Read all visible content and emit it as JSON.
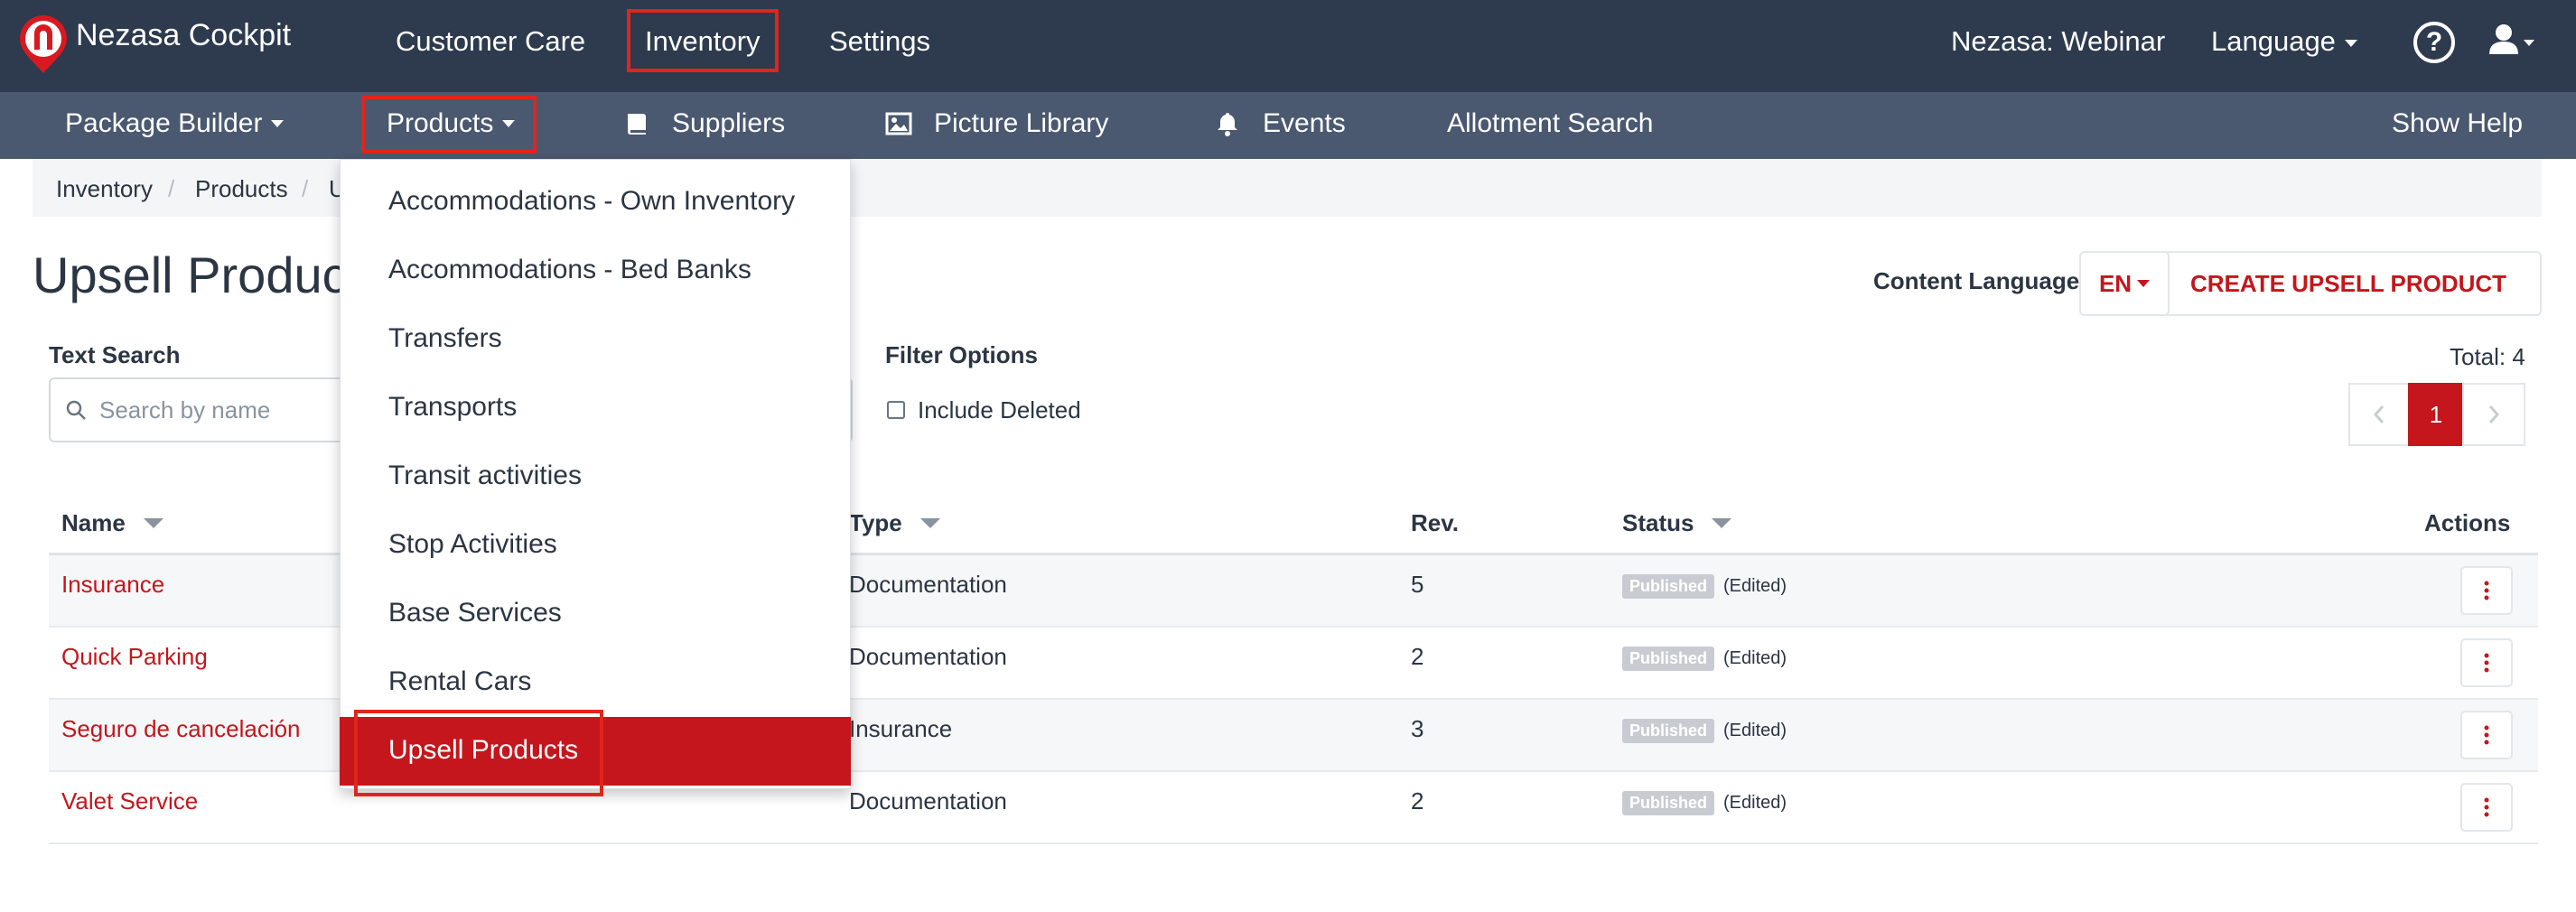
{
  "app": {
    "brand": "Nezasa Cockpit",
    "logo_icon": "nezasa-logo-icon"
  },
  "topnav": {
    "items": [
      "Customer Care",
      "Inventory",
      "Settings"
    ],
    "highlighted": "Inventory",
    "account": "Nezasa: Webinar",
    "language": "Language",
    "help_icon": "help-circle-icon",
    "user_icon": "user-icon"
  },
  "subnav": {
    "package_builder": "Package Builder",
    "products": "Products",
    "suppliers": "Suppliers",
    "picture_library": "Picture Library",
    "events": "Events",
    "allotment_search": "Allotment Search",
    "show_help": "Show Help"
  },
  "breadcrumb": [
    "Inventory",
    "Products",
    "U"
  ],
  "page": {
    "title": "Upsell Produc",
    "content_language_label": "Content Language",
    "content_language_value": "EN",
    "create_button": "CREATE UPSELL PRODUCT"
  },
  "filters": {
    "text_search_label": "Text Search",
    "search_placeholder": "Search by name",
    "filter_options_label": "Filter Options",
    "include_deleted": "Include Deleted"
  },
  "pagination": {
    "total": "Total: 4",
    "current_page": "1"
  },
  "table": {
    "headers": {
      "name": "Name",
      "type": "Type",
      "rev": "Rev.",
      "status": "Status",
      "actions": "Actions"
    },
    "rows": [
      {
        "name": "Insurance",
        "type": "Documentation",
        "rev": "5",
        "status": "Published",
        "note": "(Edited)"
      },
      {
        "name": "Quick Parking",
        "type": "Documentation",
        "rev": "2",
        "status": "Published",
        "note": "(Edited)"
      },
      {
        "name": "Seguro de cancelación",
        "type": "Insurance",
        "rev": "3",
        "status": "Published",
        "note": "(Edited)"
      },
      {
        "name": "Valet Service",
        "type": "Documentation",
        "rev": "2",
        "status": "Published",
        "note": "(Edited)"
      }
    ]
  },
  "products_menu": {
    "items": [
      "Accommodations - Own Inventory",
      "Accommodations - Bed Banks",
      "Transfers",
      "Transports",
      "Transit activities",
      "Stop Activities",
      "Base Services",
      "Rental Cars",
      "Upsell Products"
    ],
    "selected": "Upsell Products"
  },
  "colors": {
    "topbar": "#2e3a4e",
    "subbar": "#4a5870",
    "accent": "#c4161c",
    "highlight_box": "#e0251b"
  }
}
